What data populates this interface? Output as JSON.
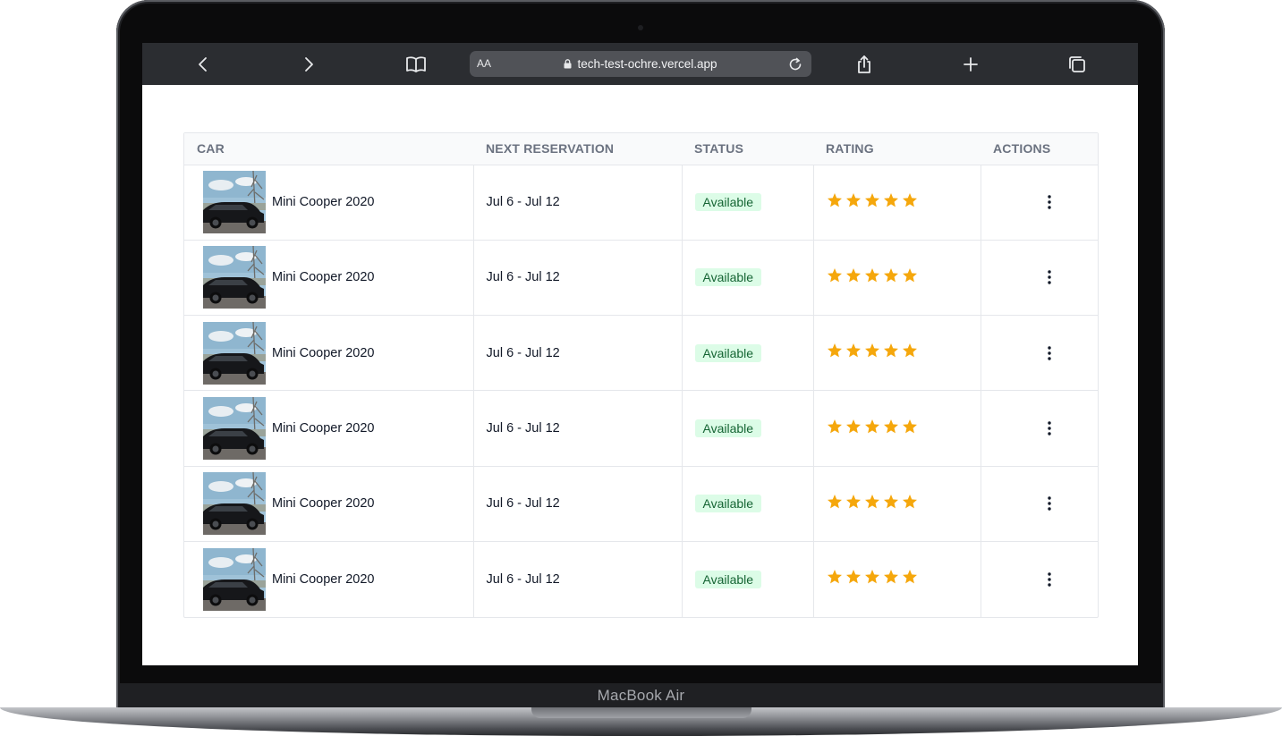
{
  "device": {
    "label": "MacBook Air"
  },
  "browser": {
    "text_size_label": "AA",
    "url": "tech-test-ochre.vercel.app"
  },
  "table": {
    "columns": [
      "CAR",
      "NEXT RESERVATION",
      "STATUS",
      "RATING",
      "ACTIONS"
    ],
    "rows": [
      {
        "car": "Mini Cooper 2020",
        "reservation": "Jul 6 - Jul 12",
        "status": "Available",
        "rating": 5
      },
      {
        "car": "Mini Cooper 2020",
        "reservation": "Jul 6 - Jul 12",
        "status": "Available",
        "rating": 5
      },
      {
        "car": "Mini Cooper 2020",
        "reservation": "Jul 6 - Jul 12",
        "status": "Available",
        "rating": 5
      },
      {
        "car": "Mini Cooper 2020",
        "reservation": "Jul 6 - Jul 12",
        "status": "Available",
        "rating": 5
      },
      {
        "car": "Mini Cooper 2020",
        "reservation": "Jul 6 - Jul 12",
        "status": "Available",
        "rating": 5
      },
      {
        "car": "Mini Cooper 2020",
        "reservation": "Jul 6 - Jul 12",
        "status": "Available",
        "rating": 5
      }
    ]
  },
  "colors": {
    "star": "#f5a70c",
    "status_bg": "#dcfce7",
    "status_text": "#166534",
    "toolbar_bg": "#2b2d31"
  }
}
